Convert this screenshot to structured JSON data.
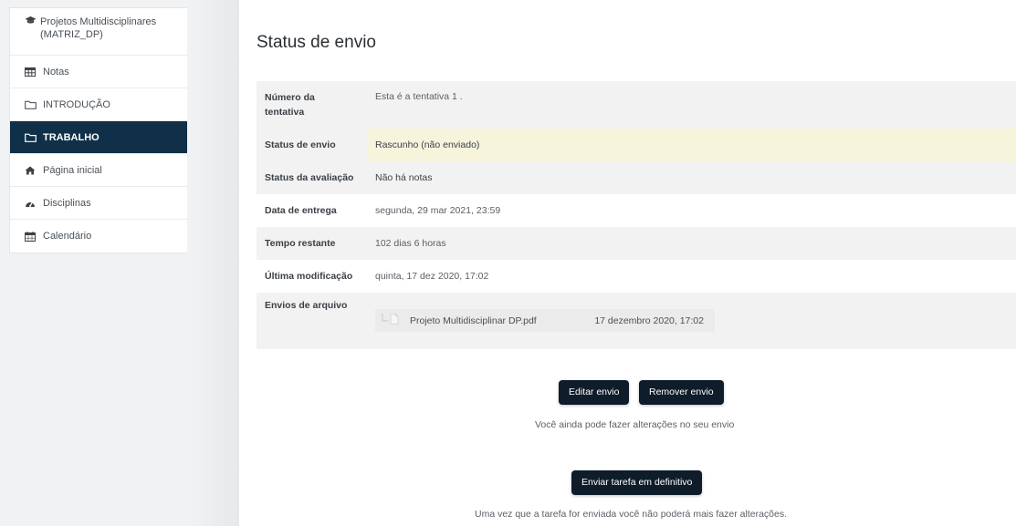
{
  "sidebar": {
    "items": [
      {
        "label": "Projetos Multidisciplinares (MATRIZ_DP)",
        "icon": "graduation-cap-icon",
        "active": false
      },
      {
        "label": "Notas",
        "icon": "table-icon",
        "active": false
      },
      {
        "label": "INTRODUÇÃO",
        "icon": "folder-icon",
        "active": false
      },
      {
        "label": "TRABALHO",
        "icon": "folder-icon",
        "active": true
      },
      {
        "label": "Página inicial",
        "icon": "home-icon",
        "active": false
      },
      {
        "label": "Disciplinas",
        "icon": "tachometer-icon",
        "active": false
      },
      {
        "label": "Calendário",
        "icon": "calendar-icon",
        "active": false
      }
    ]
  },
  "main": {
    "title": "Status de envio",
    "rows": [
      {
        "label": "Número da tentativa",
        "value": "Esta é a tentativa 1 ."
      },
      {
        "label": "Status de envio",
        "value": "Rascunho (não enviado)"
      },
      {
        "label": "Status da avaliação",
        "value": "Não há notas"
      },
      {
        "label": "Data de entrega",
        "value": "segunda, 29 mar 2021, 23:59"
      },
      {
        "label": "Tempo restante",
        "value": "102 dias 6 horas"
      },
      {
        "label": "Última modificação",
        "value": "quinta, 17 dez 2020, 17:02"
      },
      {
        "label": "Envios de arquivo",
        "file_name": "Projeto Multidisciplinar DP.pdf",
        "file_date": "17 dezembro 2020, 17:02"
      }
    ],
    "edit_button": "Editar envio",
    "remove_button": "Remover envio",
    "edit_note": "Você ainda pode fazer alterações no seu envio",
    "submit_button": "Enviar tarefa em definitivo",
    "submit_note": "Uma vez que a tarefa for enviada você não poderá mais fazer alterações."
  },
  "colors": {
    "active_nav": "#0f3048",
    "button": "#0f1c2a",
    "highlight_row": "#f7f4dc"
  }
}
